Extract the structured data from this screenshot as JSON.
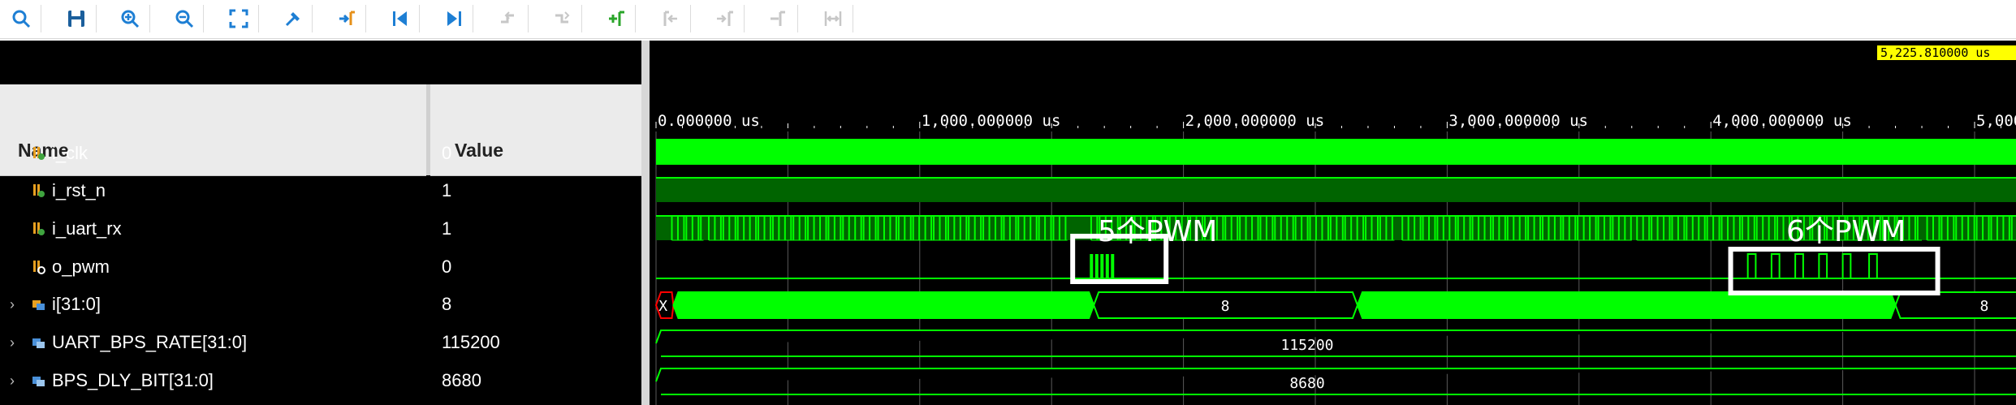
{
  "toolbar": {
    "buttons": [
      {
        "name": "search-icon",
        "enabled": true
      },
      {
        "name": "save-icon",
        "enabled": true
      },
      {
        "name": "zoom-in-icon",
        "enabled": true
      },
      {
        "name": "zoom-out-icon",
        "enabled": true
      },
      {
        "name": "zoom-fit-icon",
        "enabled": true
      },
      {
        "name": "cursor-snap-icon",
        "enabled": true
      },
      {
        "name": "go-to-time-icon",
        "enabled": true
      },
      {
        "name": "go-to-start-icon",
        "enabled": true
      },
      {
        "name": "go-to-end-icon",
        "enabled": true
      },
      {
        "name": "previous-transition-icon",
        "enabled": false
      },
      {
        "name": "next-transition-icon",
        "enabled": false
      },
      {
        "name": "add-marker-icon",
        "enabled": true
      },
      {
        "name": "previous-marker-icon",
        "enabled": false
      },
      {
        "name": "next-marker-icon",
        "enabled": false
      },
      {
        "name": "swap-cursors-icon",
        "enabled": false
      },
      {
        "name": "fix-cursor-icon",
        "enabled": false
      }
    ]
  },
  "headers": {
    "name": "Name",
    "value": "Value"
  },
  "signals": [
    {
      "name": "i_clk",
      "value": "0",
      "type": "bit",
      "expandable": false
    },
    {
      "name": "i_rst_n",
      "value": "1",
      "type": "bit",
      "expandable": false
    },
    {
      "name": "i_uart_rx",
      "value": "1",
      "type": "bit",
      "expandable": false
    },
    {
      "name": "o_pwm",
      "value": "0",
      "type": "output-bit",
      "expandable": false
    },
    {
      "name": "i[31:0]",
      "value": "8",
      "type": "bus",
      "expandable": true
    },
    {
      "name": "UART_BPS_RATE[31:0]",
      "value": "115200",
      "type": "param",
      "expandable": true
    },
    {
      "name": "BPS_DLY_BIT[31:0]",
      "value": "8680",
      "type": "param",
      "expandable": true
    }
  ],
  "timeline": {
    "cursor_label": "5,225.810000 us",
    "time_labels": [
      "0.000000 us",
      "1,000.000000 us",
      "2,000.000000 us",
      "3,000.000000 us",
      "4,000.000000 us",
      "5,000.000000 us"
    ],
    "bus_labels": {
      "i_start": "X",
      "i_mid": "8",
      "i_end": "8",
      "uart_bps_rate": "115200",
      "bps_dly_bit": "8680"
    }
  },
  "annotations": [
    "5个PWM",
    "6个PWM"
  ],
  "colors": {
    "wave": "#00ff00",
    "wave_dim": "#006400",
    "background": "#000000",
    "cursor": "#ffff00",
    "marker_box": "#ffffff",
    "x_state": "#ff0000"
  }
}
